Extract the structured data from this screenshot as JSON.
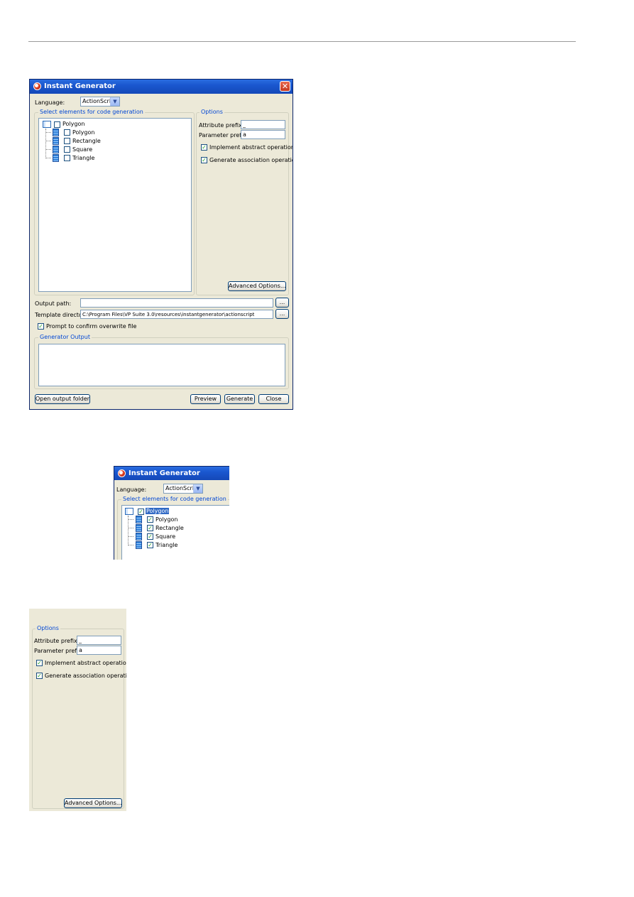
{
  "main_window": {
    "title": "Instant Generator",
    "close_glyph": "✕",
    "language_label": "Language:",
    "language_value": "ActionScript",
    "select_group_title": "Select elements for code generation",
    "tree": {
      "root": "Polygon",
      "children": [
        "Polygon",
        "Rectangle",
        "Square",
        "Triangle"
      ]
    },
    "options": {
      "group_title": "Options",
      "attribute_prefix_label": "Attribute prefix:",
      "attribute_prefix_value": "_",
      "parameter_prefix_label": "Parameter prefix:",
      "parameter_prefix_value": "a",
      "implement_abstract_label": "Implement abstract operations",
      "generate_association_label": "Generate association operations",
      "advanced_button": "Advanced Options..."
    },
    "output_path_label": "Output path:",
    "output_path_value": "",
    "template_dir_label": "Template directory:",
    "template_dir_value": "C:\\Program Files\\VP Suite 3.0\\resources\\instantgenerator\\actionscript",
    "browse_glyph": "...",
    "prompt_confirm_label": "Prompt to confirm overwrite file",
    "generator_output_title": "Generator Output",
    "buttons": {
      "open_output_folder": "Open output folder",
      "preview": "Preview",
      "generate": "Generate",
      "close": "Close"
    }
  },
  "crop_tree": {
    "title": "Instant Generator",
    "language_label": "Language:",
    "language_value": "ActionScript",
    "select_group_title": "Select elements for code generation",
    "tree": {
      "root": "Polygon",
      "children": [
        "Polygon",
        "Rectangle",
        "Square",
        "Triangle"
      ]
    }
  },
  "crop_options": {
    "group_title": "Options",
    "attribute_prefix_label": "Attribute prefix:",
    "attribute_prefix_value": "_",
    "parameter_prefix_label": "Parameter prefix:",
    "parameter_prefix_value": "a",
    "implement_abstract_label": "Implement abstract operations",
    "generate_association_label": "Generate association operations",
    "advanced_button": "Advanced Options..."
  },
  "check_glyph": "✓",
  "colors": {
    "title_blue": "#1a57cf",
    "group_title": "#0046d5",
    "dialog_bg": "#ece9d8",
    "selection": "#316ac5"
  }
}
